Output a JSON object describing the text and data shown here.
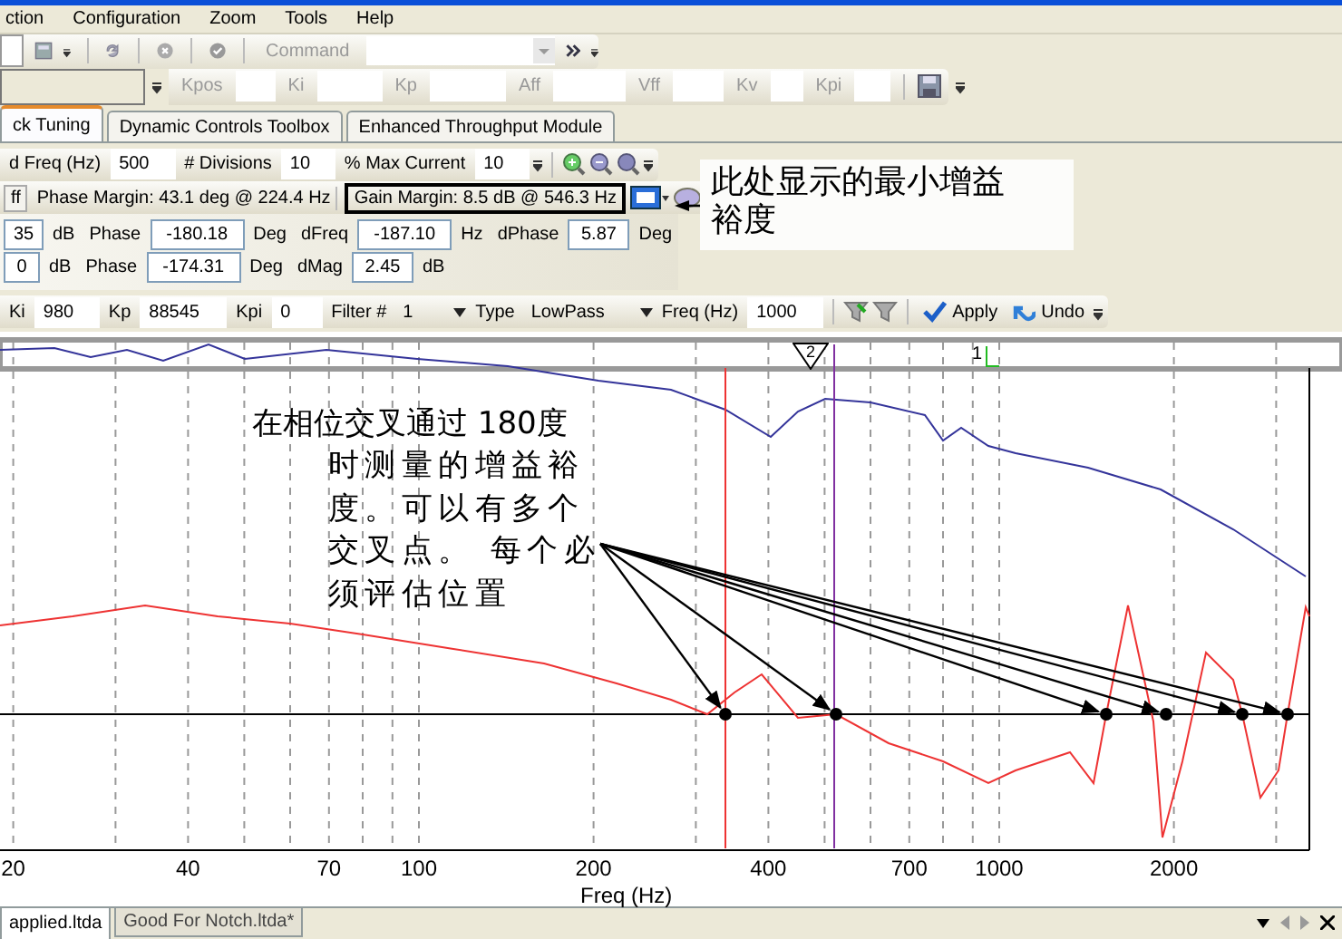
{
  "menu": [
    "ction",
    "Configuration",
    "Zoom",
    "Tools",
    "Help"
  ],
  "command_bar": {
    "label": "Command"
  },
  "gain_fields": [
    {
      "label": "Kpos"
    },
    {
      "label": "Ki"
    },
    {
      "label": "Kp"
    },
    {
      "label": "Aff"
    },
    {
      "label": "Vff"
    },
    {
      "label": "Kv"
    },
    {
      "label": "Kpi"
    }
  ],
  "tabs": [
    {
      "label": "ck Tuning",
      "selected": true
    },
    {
      "label": "Dynamic Controls Toolbox",
      "selected": false
    },
    {
      "label": "Enhanced Throughput Module",
      "selected": false
    }
  ],
  "sweep_row": [
    {
      "kind": "label",
      "text": "d Freq (Hz)"
    },
    {
      "kind": "field",
      "value": "500"
    },
    {
      "kind": "label",
      "text": "# Divisions"
    },
    {
      "kind": "field",
      "value": "10"
    },
    {
      "kind": "label",
      "text": "% Max Current"
    },
    {
      "kind": "field",
      "value": "10"
    },
    {
      "kind": "zoom"
    }
  ],
  "margin_row": [
    {
      "kind": "button",
      "text": "ff"
    },
    {
      "kind": "readout",
      "text": "Phase Margin: 43.1 deg @ 224.4 Hz",
      "highlighted": false
    },
    {
      "kind": "readout",
      "text": "Gain Margin: 8.5 dB @ 546.3 Hz",
      "highlighted": true
    },
    {
      "kind": "tools"
    }
  ],
  "cursor_rows": [
    [
      {
        "kind": "field",
        "value": "35"
      },
      {
        "kind": "label",
        "text": "dB"
      },
      {
        "kind": "label",
        "text": "Phase"
      },
      {
        "kind": "field",
        "value": "-180.18"
      },
      {
        "kind": "label",
        "text": "Deg"
      },
      {
        "kind": "label",
        "text": "dFreq"
      },
      {
        "kind": "field",
        "value": "-187.10"
      },
      {
        "kind": "label",
        "text": "Hz"
      },
      {
        "kind": "label",
        "text": "dPhase"
      },
      {
        "kind": "field",
        "value": "5.87"
      },
      {
        "kind": "label",
        "text": "Deg"
      }
    ],
    [
      {
        "kind": "field",
        "value": "0"
      },
      {
        "kind": "label",
        "text": "dB"
      },
      {
        "kind": "label",
        "text": "Phase"
      },
      {
        "kind": "field",
        "value": "-174.31"
      },
      {
        "kind": "label",
        "text": "Deg"
      },
      {
        "kind": "label",
        "text": "dMag"
      },
      {
        "kind": "field",
        "value": "2.45"
      },
      {
        "kind": "label",
        "text": "dB"
      }
    ]
  ],
  "filter_row": [
    {
      "kind": "label",
      "text": "Ki"
    },
    {
      "kind": "field",
      "value": "980"
    },
    {
      "kind": "label",
      "text": "Kp"
    },
    {
      "kind": "field",
      "value": "88545"
    },
    {
      "kind": "label",
      "text": "Kpi"
    },
    {
      "kind": "field",
      "value": "0"
    },
    {
      "kind": "label",
      "text": "Filter #"
    },
    {
      "kind": "dropdown",
      "value": "1"
    },
    {
      "kind": "label",
      "text": "Type"
    },
    {
      "kind": "dropdown",
      "value": "LowPass"
    },
    {
      "kind": "label",
      "text": "Freq (Hz)"
    },
    {
      "kind": "field",
      "value": "1000"
    },
    {
      "kind": "filters"
    },
    {
      "kind": "confirm",
      "text": "Apply"
    },
    {
      "kind": "revert",
      "text": "Undo"
    }
  ],
  "callout": "此处显示的最小增益裕度",
  "chart": {
    "cursors": [
      {
        "kind": "triangle",
        "label": "2"
      },
      {
        "kind": "bracket",
        "label": "1"
      }
    ],
    "annotation": [
      "在相位交叉通过 180度",
      "时测量的增益裕",
      "度。可以有多个",
      "交叉点。 每个必",
      "须评估位置"
    ],
    "x_ticks": [
      "20",
      "40",
      "70",
      "100",
      "200",
      "400",
      "700",
      "1000",
      "2000"
    ],
    "x_label": "Freq (Hz)"
  },
  "doc_tabs": [
    {
      "label": "applied.ltda",
      "selected": true
    },
    {
      "label": "Good For Notch.ltda*",
      "selected": false
    }
  ]
}
